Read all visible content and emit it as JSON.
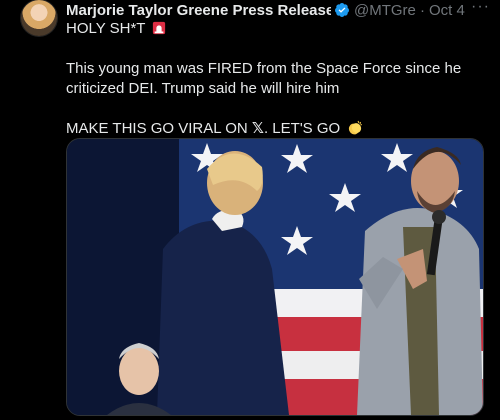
{
  "tweet": {
    "author_name": "Marjorie Taylor Greene Press Release (Pa",
    "handle": "@MTGrep",
    "separator": "·",
    "timestamp": "Oct 4",
    "more_label": "···",
    "verified": true,
    "lines": {
      "l1": "HOLY SH*T",
      "l2": "This young man was FIRED from the Space Force since he criticized DEI. Trump said he will hire him",
      "l3a": "MAKE THIS GO VIRAL ON ",
      "l3x": "𝕏",
      "l3b": ". LET'S GO"
    },
    "icons": {
      "avatar": "profile-photo",
      "verified": "verified-badge-icon",
      "siren": "police-light-emoji",
      "clap": "clapping-hands-emoji"
    },
    "colors": {
      "background": "#000000",
      "text": "#e7e9ea",
      "muted": "#71767b",
      "verified_blue": "#1d9bf0"
    },
    "media": {
      "type": "video-still",
      "description_icon": "event-stage-photo"
    }
  }
}
